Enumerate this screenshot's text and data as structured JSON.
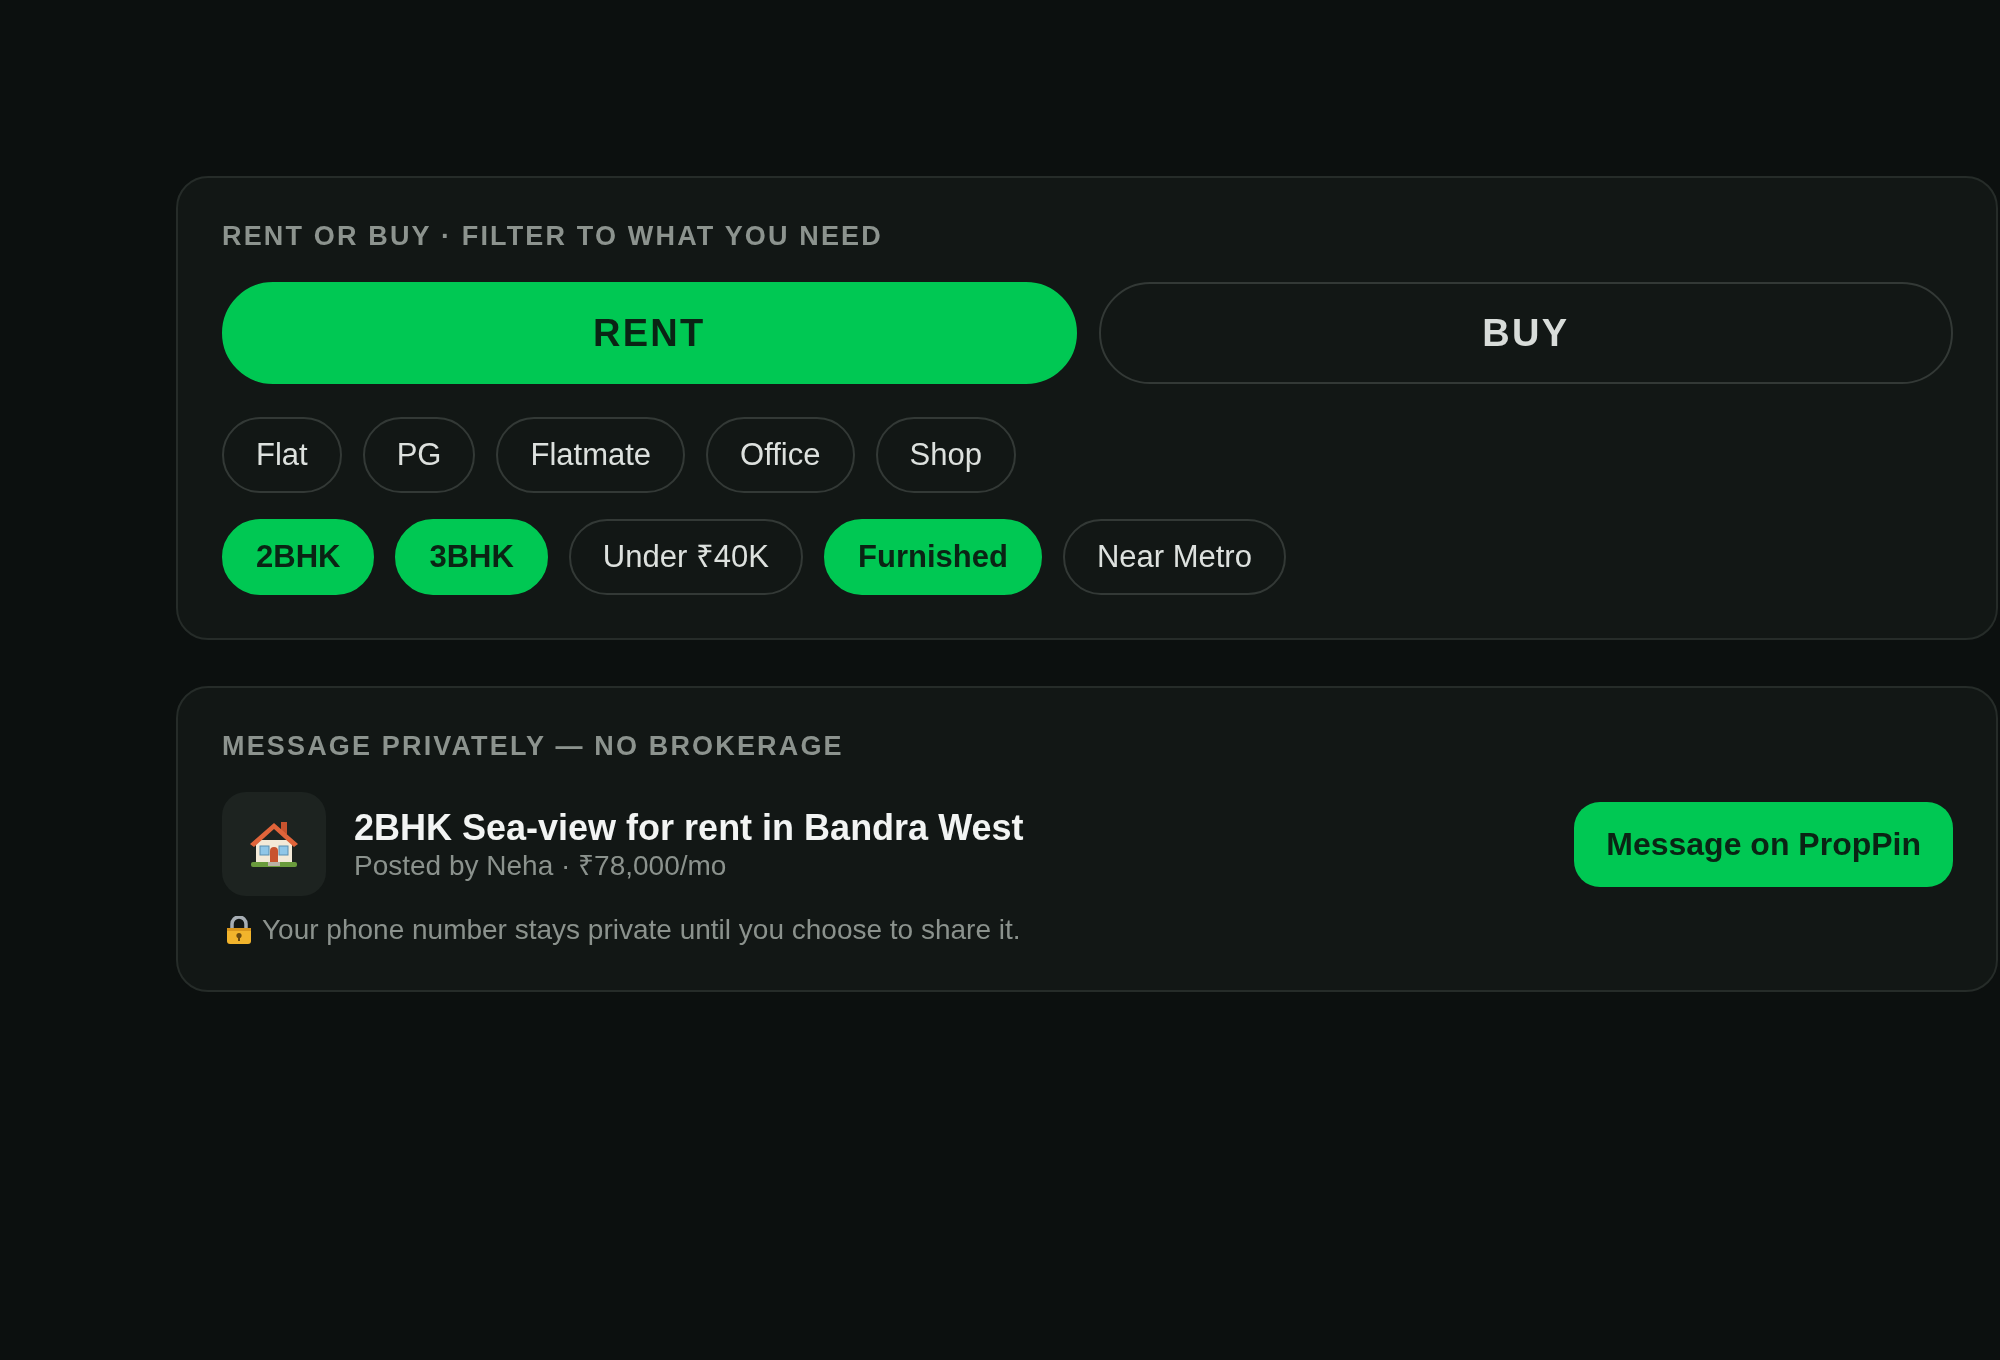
{
  "filter_panel": {
    "heading": "RENT OR BUY · FILTER TO WHAT YOU NEED",
    "modes": [
      {
        "label": "RENT",
        "selected": true
      },
      {
        "label": "BUY",
        "selected": false
      }
    ],
    "property_types": [
      {
        "label": "Flat",
        "selected": false
      },
      {
        "label": "PG",
        "selected": false
      },
      {
        "label": "Flatmate",
        "selected": false
      },
      {
        "label": "Office",
        "selected": false
      },
      {
        "label": "Shop",
        "selected": false
      }
    ],
    "filters": [
      {
        "label": "2BHK",
        "selected": true
      },
      {
        "label": "3BHK",
        "selected": true
      },
      {
        "label": "Under ₹40K",
        "selected": false
      },
      {
        "label": "Furnished",
        "selected": true
      },
      {
        "label": "Near Metro",
        "selected": false
      }
    ]
  },
  "message_panel": {
    "heading": "MESSAGE PRIVATELY — NO BROKERAGE",
    "listing": {
      "title": "2BHK Sea-view for rent in Bandra West",
      "subtitle": "Posted by Neha · ₹78,000/mo"
    },
    "button": "Message on PropPin",
    "privacy_note": "Your phone number stays private until you choose to share it."
  }
}
